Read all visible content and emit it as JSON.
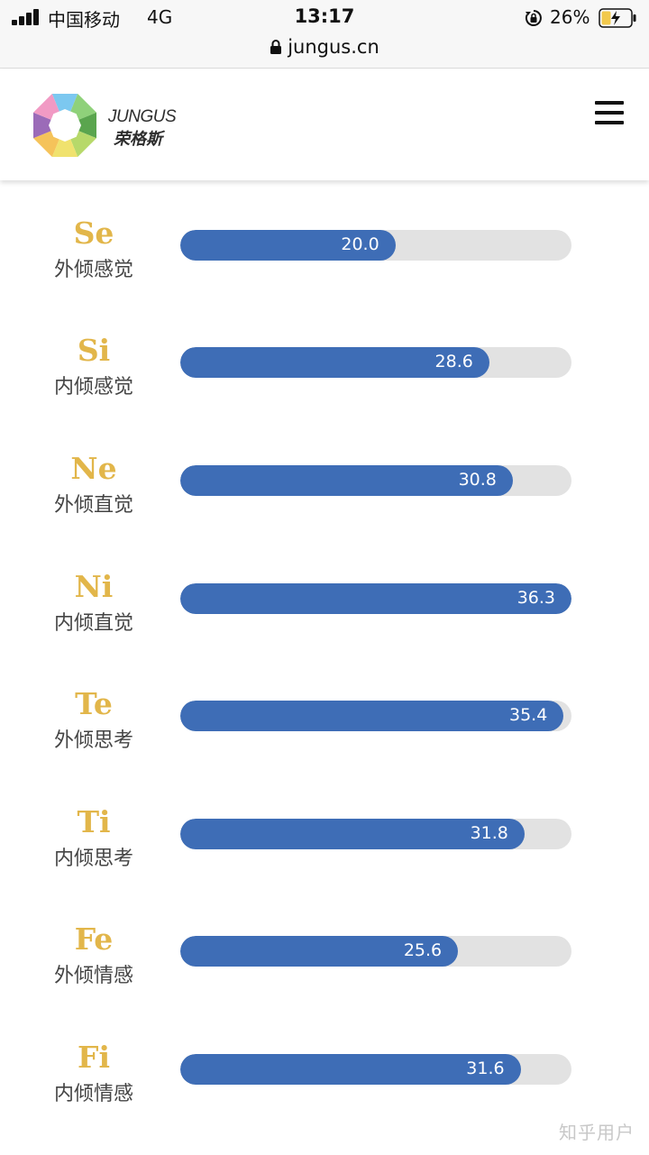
{
  "status_bar": {
    "carrier": "中国移动",
    "network": "4G",
    "time": "13:17",
    "battery": "26%"
  },
  "browser": {
    "url": "jungus.cn"
  },
  "header": {
    "logo_en": "JUNGUS",
    "logo_cn": "荣格斯"
  },
  "functions": [
    {
      "code": "Se",
      "name": "外倾感觉",
      "value": "20.0",
      "fill_percent": 55
    },
    {
      "code": "Si",
      "name": "内倾感觉",
      "value": "28.6",
      "fill_percent": 79
    },
    {
      "code": "Ne",
      "name": "外倾直觉",
      "value": "30.8",
      "fill_percent": 85
    },
    {
      "code": "Ni",
      "name": "内倾直觉",
      "value": "36.3",
      "fill_percent": 100
    },
    {
      "code": "Te",
      "name": "外倾思考",
      "value": "35.4",
      "fill_percent": 98
    },
    {
      "code": "Ti",
      "name": "内倾思考",
      "value": "31.8",
      "fill_percent": 88
    },
    {
      "code": "Fe",
      "name": "外倾情感",
      "value": "25.6",
      "fill_percent": 71
    },
    {
      "code": "Fi",
      "name": "内倾情感",
      "value": "31.6",
      "fill_percent": 87
    }
  ],
  "watermark": "知乎用户",
  "colors": {
    "bar_fill": "#3e6db6",
    "bar_track": "#e2e2e2",
    "code_text": "#e2b64a"
  }
}
